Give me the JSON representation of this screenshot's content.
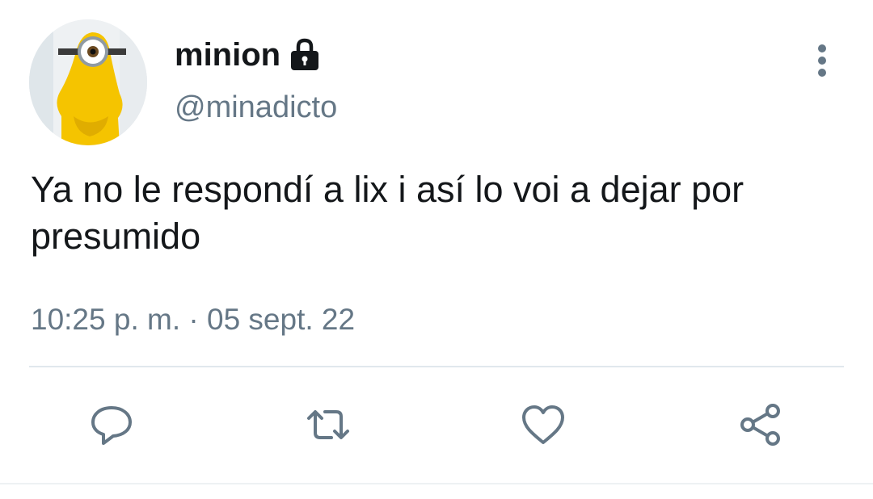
{
  "tweet": {
    "display_name": "minion",
    "handle": "@minadicto",
    "text": "Ya no le respondí a lix i así lo voi a dejar por presumido",
    "timestamp": "10:25 p. m. · 05 sept. 22",
    "protected": true
  },
  "icons": {
    "lock": "lock-icon",
    "more": "more-vertical-icon",
    "reply": "reply-icon",
    "retweet": "retweet-icon",
    "like": "heart-icon",
    "share": "share-icon"
  },
  "colors": {
    "text_primary": "#14171a",
    "text_secondary": "#657786",
    "icon": "#657786",
    "divider": "#e1e8ed",
    "avatar_yellow": "#f5c400"
  }
}
